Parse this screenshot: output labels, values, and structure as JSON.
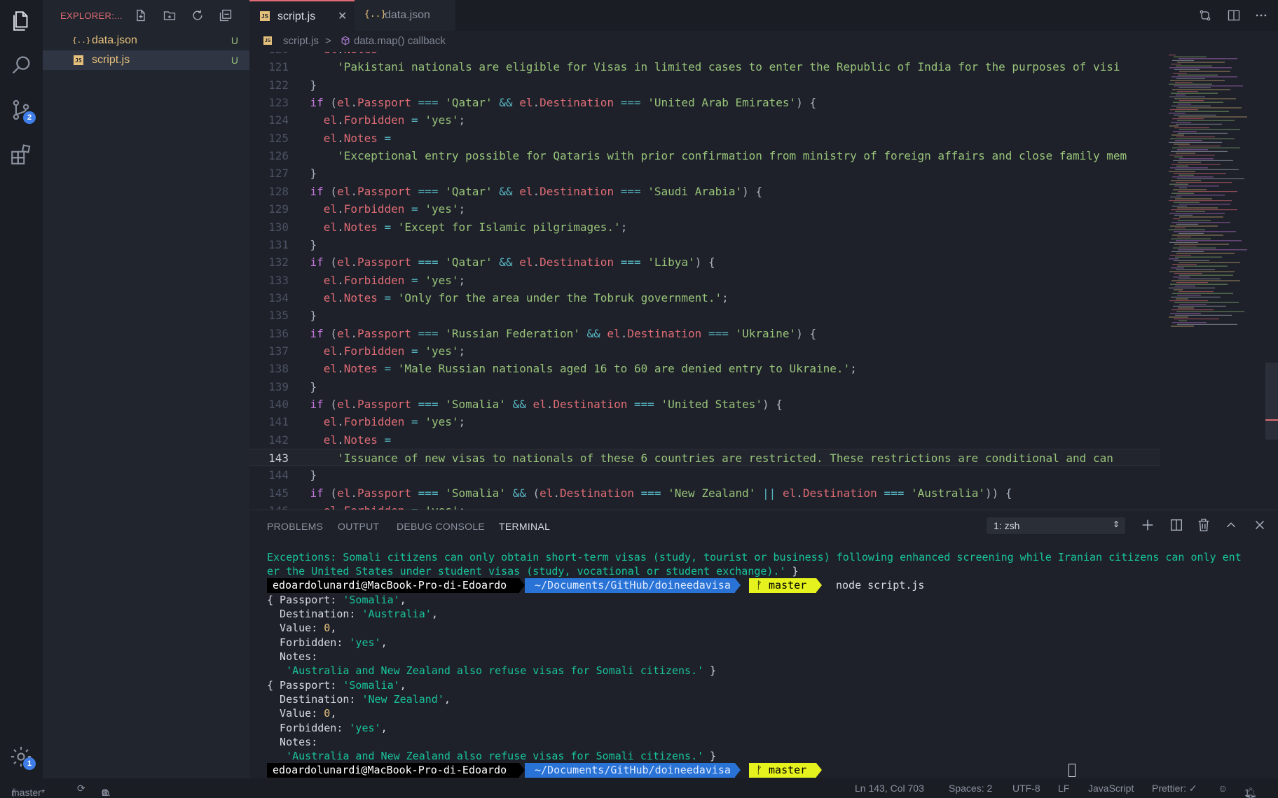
{
  "explorer": {
    "title": "EXPLORER:...",
    "files": [
      {
        "name": "data.json",
        "status": "U",
        "icon": "{..}"
      },
      {
        "name": "script.js",
        "status": "U",
        "icon": "JS"
      }
    ]
  },
  "activity": {
    "scm_badge": "2",
    "settings_badge": "1"
  },
  "tabs": [
    {
      "label": "script.js",
      "close": "✕",
      "icon": "JS"
    },
    {
      "label": "data.json",
      "icon": "{..}"
    }
  ],
  "breadcrumb": {
    "file": "script.js",
    "separator": ">",
    "symbol": "data.map() callback"
  },
  "editor": {
    "lines": [
      {
        "n": "120",
        "text": "      el.Notes ="
      },
      {
        "n": "121",
        "text": "        'Pakistani nationals are eligible for Visas in limited cases to enter the Republic of India for the purposes of visi"
      },
      {
        "n": "122",
        "text": "    }"
      },
      {
        "n": "123",
        "text": "    if (el.Passport === 'Qatar' && el.Destination === 'United Arab Emirates') {"
      },
      {
        "n": "124",
        "text": "      el.Forbidden = 'yes';"
      },
      {
        "n": "125",
        "text": "      el.Notes ="
      },
      {
        "n": "126",
        "text": "        'Exceptional entry possible for Qataris with prior confirmation from ministry of foreign affairs and close family mem"
      },
      {
        "n": "127",
        "text": "    }"
      },
      {
        "n": "128",
        "text": "    if (el.Passport === 'Qatar' && el.Destination === 'Saudi Arabia') {"
      },
      {
        "n": "129",
        "text": "      el.Forbidden = 'yes';"
      },
      {
        "n": "130",
        "text": "      el.Notes = 'Except for Islamic pilgrimages.';"
      },
      {
        "n": "131",
        "text": "    }"
      },
      {
        "n": "132",
        "text": "    if (el.Passport === 'Qatar' && el.Destination === 'Libya') {"
      },
      {
        "n": "133",
        "text": "      el.Forbidden = 'yes';"
      },
      {
        "n": "134",
        "text": "      el.Notes = 'Only for the area under the Tobruk government.';"
      },
      {
        "n": "135",
        "text": "    }"
      },
      {
        "n": "136",
        "text": "    if (el.Passport === 'Russian Federation' && el.Destination === 'Ukraine') {"
      },
      {
        "n": "137",
        "text": "      el.Forbidden = 'yes';"
      },
      {
        "n": "138",
        "text": "      el.Notes = 'Male Russian nationals aged 16 to 60 are denied entry to Ukraine.';"
      },
      {
        "n": "139",
        "text": "    }"
      },
      {
        "n": "140",
        "text": "    if (el.Passport === 'Somalia' && el.Destination === 'United States') {"
      },
      {
        "n": "141",
        "text": "      el.Forbidden = 'yes';"
      },
      {
        "n": "142",
        "text": "      el.Notes ="
      },
      {
        "n": "143",
        "text": "        'Issuance of new visas to nationals of these 6 countries are restricted. These restrictions are conditional and can"
      },
      {
        "n": "144",
        "text": "    }"
      },
      {
        "n": "145",
        "text": "    if (el.Passport === 'Somalia' && (el.Destination === 'New Zealand' || el.Destination === 'Australia')) {"
      },
      {
        "n": "146",
        "text": "      el.Forbidden = 'yes';"
      }
    ],
    "current_line": "143"
  },
  "panel": {
    "tabs": [
      "PROBLEMS",
      "OUTPUT",
      "DEBUG CONSOLE",
      "TERMINAL"
    ],
    "active_tab": "TERMINAL",
    "terminal_select": "1: zsh",
    "terminal": {
      "l1": "Exceptions: Somali citizens can only obtain short-term visas (study, tourist or business) following enhanced screening while Iranian citizens can only ent",
      "l2": "er the United States under student visas (study, vocational or student exchange).'",
      "l2_end": " }",
      "prompt_user": "edoardolunardi@MacBook-Pro-di-Edoardo",
      "prompt_dir": "~/Documents/GitHub/doineedavisa",
      "prompt_branch": "master",
      "command": "node script.js",
      "obj1": {
        "passport_key": "{ Passport: ",
        "passport": "'Somalia'",
        "dest_key": "  Destination: ",
        "dest": "'Australia'",
        "value_key": "  Value: ",
        "value": "0",
        "forb_key": "  Forbidden: ",
        "forb": "'yes'",
        "notes_key": "  Notes:",
        "notes": "'Australia and New Zealand also refuse visas for Somali citizens.'",
        "end": " }"
      },
      "obj2": {
        "passport_key": "{ Passport: ",
        "passport": "'Somalia'",
        "dest_key": "  Destination: ",
        "dest": "'New Zealand'",
        "value_key": "  Value: ",
        "value": "0",
        "forb_key": "  Forbidden: ",
        "forb": "'yes'",
        "notes_key": "  Notes:",
        "notes": "'Australia and New Zealand also refuse visas for Somali citizens.'",
        "end": " }"
      }
    }
  },
  "status": {
    "branch": "master*",
    "errors": "0",
    "warnings": "0",
    "position": "Ln 143, Col 703",
    "spaces": "Spaces: 2",
    "encoding": "UTF-8",
    "eol": "LF",
    "language": "JavaScript",
    "prettier": "Prettier: ✓",
    "notifications": "1"
  },
  "colors": {
    "accent": "#e06c75",
    "keyword": "#c678dd",
    "string": "#98c379",
    "badge": "#3f7ee8"
  }
}
